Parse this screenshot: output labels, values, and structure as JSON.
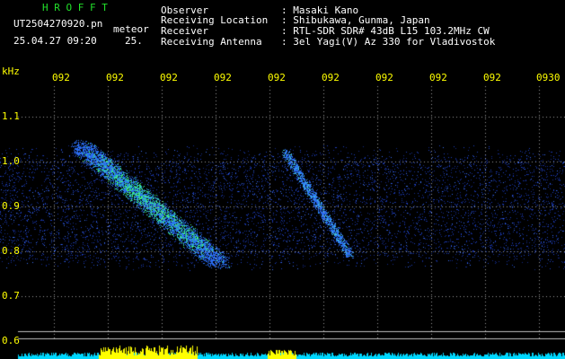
{
  "header": {
    "app_title": "H R O F F T",
    "filename": "UT2504270920.pn",
    "overlay_label": "meteor",
    "datetime": "25.04.27 09:20",
    "extra": "25.",
    "fields": [
      {
        "label": "Observer",
        "value": ": Masaki Kano"
      },
      {
        "label": "Receiving Location",
        "value": ": Shibukawa, Gunma, Japan"
      },
      {
        "label": "Receiver",
        "value": ": RTL-SDR SDR# 43dB L15 103.2MHz CW"
      },
      {
        "label": "Receiving Antenna",
        "value": ": 3el Yagi(V) Az 330 for Vladivostok"
      }
    ]
  },
  "axis": {
    "unit": "kHz",
    "time_ticks": [
      "092",
      "092",
      "092",
      "092",
      "092",
      "092",
      "092",
      "092",
      "092",
      "0930"
    ],
    "freq_ticks": [
      "1.1",
      "1.0",
      "0.9",
      "0.8",
      "0.7",
      "0.6"
    ]
  },
  "colors": {
    "text": "#ffffff",
    "title": "#22e02a",
    "tick_labels": "#ffff00",
    "noise": "#1f3fbf",
    "signal": "#30e070"
  }
}
